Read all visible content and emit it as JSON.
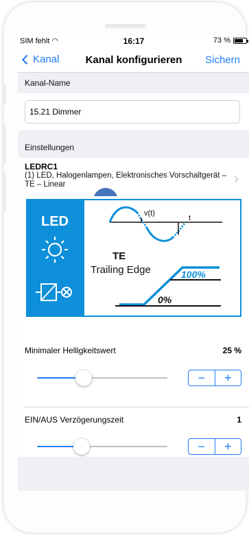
{
  "status_bar": {
    "carrier": "SIM fehlt",
    "time": "16:17",
    "battery": "73 %",
    "battery_level": 0.73
  },
  "nav": {
    "back_label": "Kanal",
    "title": "Kanal konfigurieren",
    "save_label": "Sichern"
  },
  "channel_name": {
    "header": "Kanal-Name",
    "value": "15.21 Dimmer"
  },
  "settings": {
    "header": "Einstellungen",
    "mode_title": "LEDRC1",
    "mode_description": "(1) LED, Halogenlampen, Elektronisches Vorschaltgerät – TE – Linear"
  },
  "diagram": {
    "led_label": "LED",
    "signal_label": "v(t)",
    "time_label": "t",
    "te_label": "TE",
    "trailing_edge_label": "Trailing Edge",
    "max_label": "100%",
    "min_label": "0%",
    "accent_color": "#0d8fd9"
  },
  "brightness": {
    "label": "Minimaler Helligkeitswert",
    "value": "25 %",
    "slider_fraction": 0.36
  },
  "delay": {
    "label": "EIN/AUS Verzögerungszeit",
    "value": "1",
    "slider_fraction": 0.34
  },
  "stepper": {
    "minus": "−",
    "plus": "+"
  },
  "colors": {
    "accent": "#1d7cf2",
    "background": "#efeff4"
  }
}
